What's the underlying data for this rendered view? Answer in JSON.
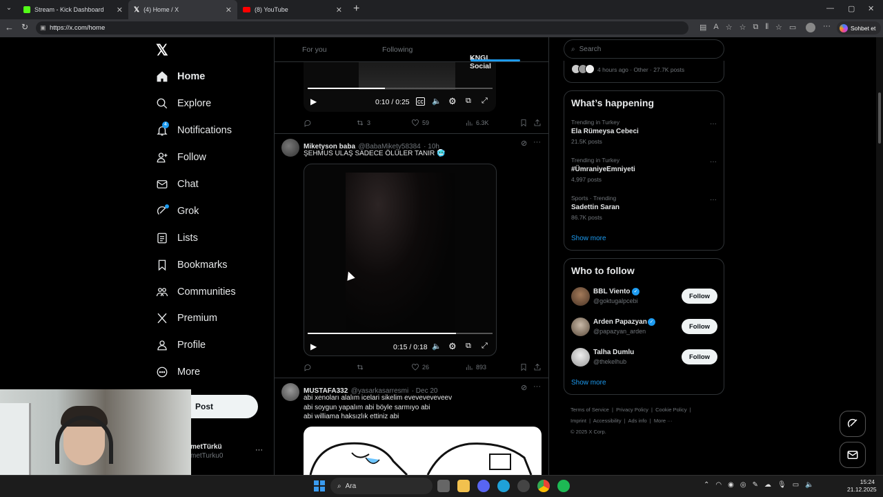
{
  "browser": {
    "tabs": [
      {
        "title": "Stream - Kick Dashboard",
        "icon": "kick-icon",
        "color": "#53fc18"
      },
      {
        "title": "(4) Home / X",
        "icon": "x-icon",
        "color": "#ffffff"
      },
      {
        "title": "(8) YouTube",
        "icon": "youtube-icon",
        "color": "#ff0000"
      }
    ],
    "url": "https://x.com/home",
    "copilot_label": "Sohbet et"
  },
  "nav": {
    "items": [
      {
        "label": "Home",
        "icon": "home-icon"
      },
      {
        "label": "Explore",
        "icon": "search-icon"
      },
      {
        "label": "Notifications",
        "icon": "bell-icon",
        "badge": "4"
      },
      {
        "label": "Follow",
        "icon": "person-add-icon"
      },
      {
        "label": "Chat",
        "icon": "mail-icon"
      },
      {
        "label": "Grok",
        "icon": "grok-icon"
      },
      {
        "label": "Lists",
        "icon": "list-icon"
      },
      {
        "label": "Bookmarks",
        "icon": "bookmark-icon"
      },
      {
        "label": "Communities",
        "icon": "communities-icon"
      },
      {
        "label": "Premium",
        "icon": "x-icon"
      },
      {
        "label": "Profile",
        "icon": "profile-icon"
      },
      {
        "label": "More",
        "icon": "more-circle-icon"
      }
    ],
    "post_label": "Post",
    "account_name": "metTürkü",
    "account_handle": "metTurku0"
  },
  "timeline": {
    "tabs": [
      "For you",
      "Following",
      "KNGL Social"
    ],
    "tweet0": {
      "time": "0:10 / 0:25",
      "replies": "",
      "retweets": "3",
      "likes": "59",
      "views": "6.3K"
    },
    "tweet1": {
      "name": "Miketyson baba",
      "handle": "@BabaMikety58384",
      "time": "· 10h",
      "text": "ŞEHMUS ULAŞ SADECE ÖLÜLER TANIR 🥶",
      "video_time": "0:15 / 0:18",
      "replies": "",
      "retweets": "",
      "likes": "26",
      "views": "893"
    },
    "tweet2": {
      "name": "MUSTAFA332",
      "handle": "@yasarkasarresmi",
      "time": "· Dec 20",
      "lines": [
        "abi xenoları alalım icelari sikelim eveveveveveev",
        "abi soygun yapalım abi böyle sarmıyo abi",
        "abi williama haksızlık ettiniz abi"
      ]
    }
  },
  "search": {
    "placeholder": "Search"
  },
  "top_card": {
    "meta": "4 hours ago · Other · 27.7K posts"
  },
  "happening": {
    "title": "What’s happening",
    "items": [
      {
        "sub": "Trending in Turkey",
        "main": "Ela Rümeysa Cebeci",
        "count": "21.5K posts"
      },
      {
        "sub": "Trending in Turkey",
        "main": "#ÜmraniyeEmniyeti",
        "count": "4,997 posts"
      },
      {
        "sub": "Sports · Trending",
        "main": "Sadettin Saran",
        "count": "86.7K posts"
      }
    ],
    "show_more": "Show more"
  },
  "who_to_follow": {
    "title": "Who to follow",
    "users": [
      {
        "name": "BBL Viento",
        "handle": "@goktugalpcebi",
        "verified": true
      },
      {
        "name": "Arden Papazyan",
        "handle": "@papazyan_arden",
        "verified": true
      },
      {
        "name": "Talha Dumlu",
        "handle": "@thekelhub",
        "verified": false
      }
    ],
    "follow_label": "Follow",
    "show_more": "Show more"
  },
  "footer": {
    "row1": [
      "Terms of Service",
      "Privacy Policy",
      "Cookie Policy"
    ],
    "row2": [
      "Imprint",
      "Accessibility",
      "Ads info",
      "More ···"
    ],
    "copyright": "© 2025 X Corp."
  },
  "taskbar": {
    "search": "Ara",
    "time": "15:24",
    "date": "21.12.2025"
  },
  "colors": {
    "accent": "#1d9bf0",
    "border": "#2f3336",
    "muted": "#71767b"
  }
}
